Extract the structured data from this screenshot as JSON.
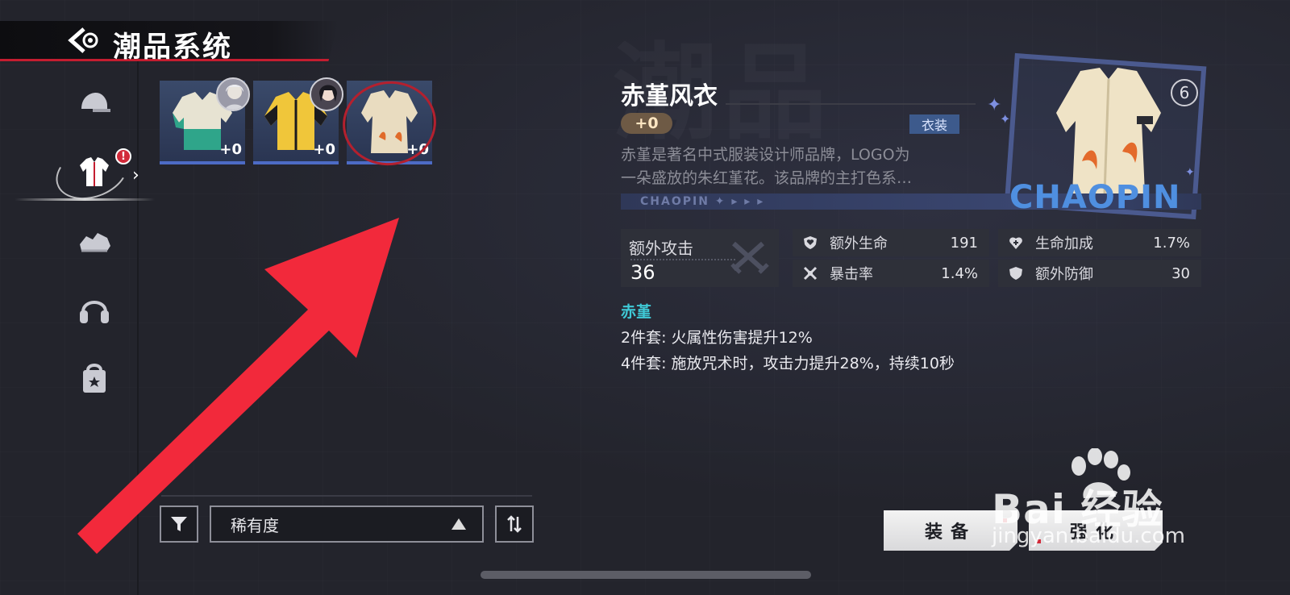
{
  "header": {
    "title": "潮品系统"
  },
  "sidebar": {
    "items": [
      {
        "id": "hat",
        "icon": "cap-icon"
      },
      {
        "id": "jacket",
        "icon": "jacket-icon",
        "active": true,
        "badge": "!"
      },
      {
        "id": "shoes",
        "icon": "sneaker-icon"
      },
      {
        "id": "headphones",
        "icon": "headphones-icon"
      },
      {
        "id": "bag",
        "icon": "bag-icon"
      }
    ]
  },
  "inventory": {
    "items": [
      {
        "plus": "+0",
        "has_owner": true
      },
      {
        "plus": "+0",
        "has_owner": true
      },
      {
        "plus": "+0",
        "has_owner": false,
        "selected": true
      }
    ]
  },
  "controls": {
    "sort_label": "稀有度"
  },
  "detail": {
    "name": "赤堇风衣",
    "level": "+0",
    "type": "衣装",
    "description_line1": "赤堇是著名中式服装设计师品牌，LOGO为",
    "description_line2": "一朵盛放的朱红堇花。该品牌的主打色系…",
    "strip_text": "CHAOPIN",
    "art_text": "CHAOPIN",
    "rank": "6",
    "main_stat": {
      "label": "额外攻击",
      "value": "36"
    },
    "stats": [
      {
        "label": "额外生命",
        "value": "191",
        "icon": "heart-shield-icon"
      },
      {
        "label": "生命加成",
        "value": "1.7%",
        "icon": "heart-plus-icon"
      },
      {
        "label": "暴击率",
        "value": "1.4%",
        "icon": "crossed-swords-icon"
      },
      {
        "label": "额外防御",
        "value": "30",
        "icon": "shield-icon"
      }
    ],
    "set_name": "赤堇",
    "set_bonus_2": "2件套: 火属性伤害提升12%",
    "set_bonus_4": "4件套: 施放咒术时，攻击力提升28%，持续10秒"
  },
  "buttons": {
    "equip": "装备",
    "enhance": "强化"
  },
  "watermark": {
    "brand": "Bai  经验",
    "url": "jingyan.baidu.com"
  },
  "colors": {
    "accent_red": "#c41d30",
    "rarity_blue": "#4d6bc5",
    "set_cyan": "#3fc9d6",
    "level_brown": "#6e5a45"
  }
}
